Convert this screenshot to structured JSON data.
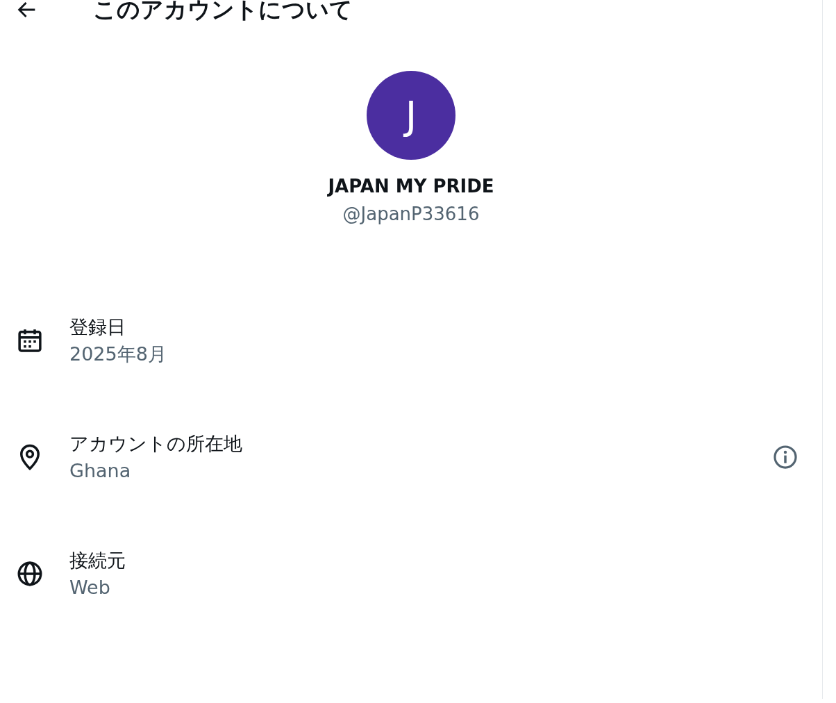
{
  "header": {
    "title": "このアカウントについて"
  },
  "profile": {
    "initial": "J",
    "color": "#4b2ea0",
    "name": "JAPAN MY PRIDE",
    "handle": "@JapanP33616"
  },
  "details": [
    {
      "kind": "calendar",
      "label": "登録日",
      "value": "2025年8月",
      "info": false
    },
    {
      "kind": "location",
      "label": "アカウントの所在地",
      "value": "Ghana",
      "info": true
    },
    {
      "kind": "globe",
      "label": "接続元",
      "value": "Web",
      "info": false
    }
  ]
}
